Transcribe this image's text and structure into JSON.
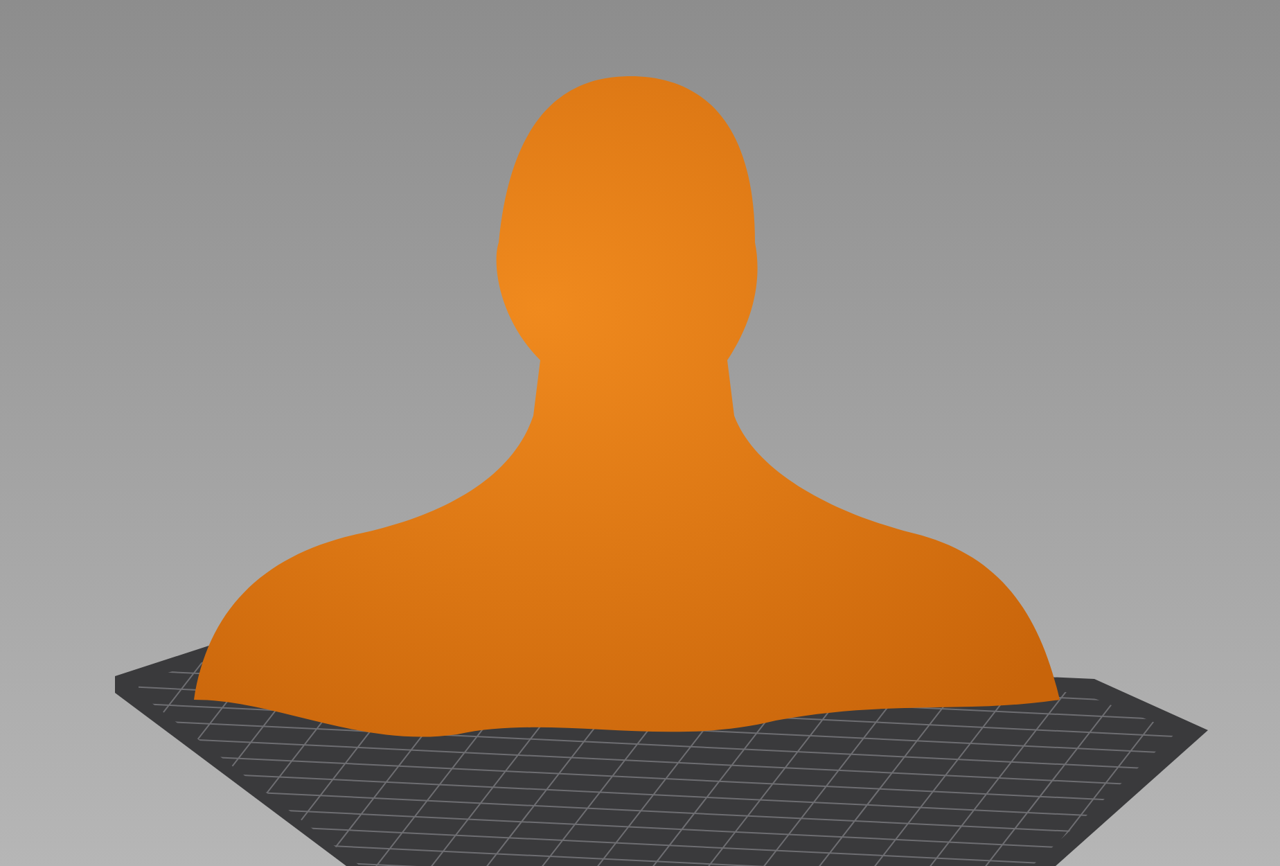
{
  "viewport": {
    "objects": [
      {
        "kind": "bed"
      },
      {
        "kind": "bust"
      }
    ]
  }
}
